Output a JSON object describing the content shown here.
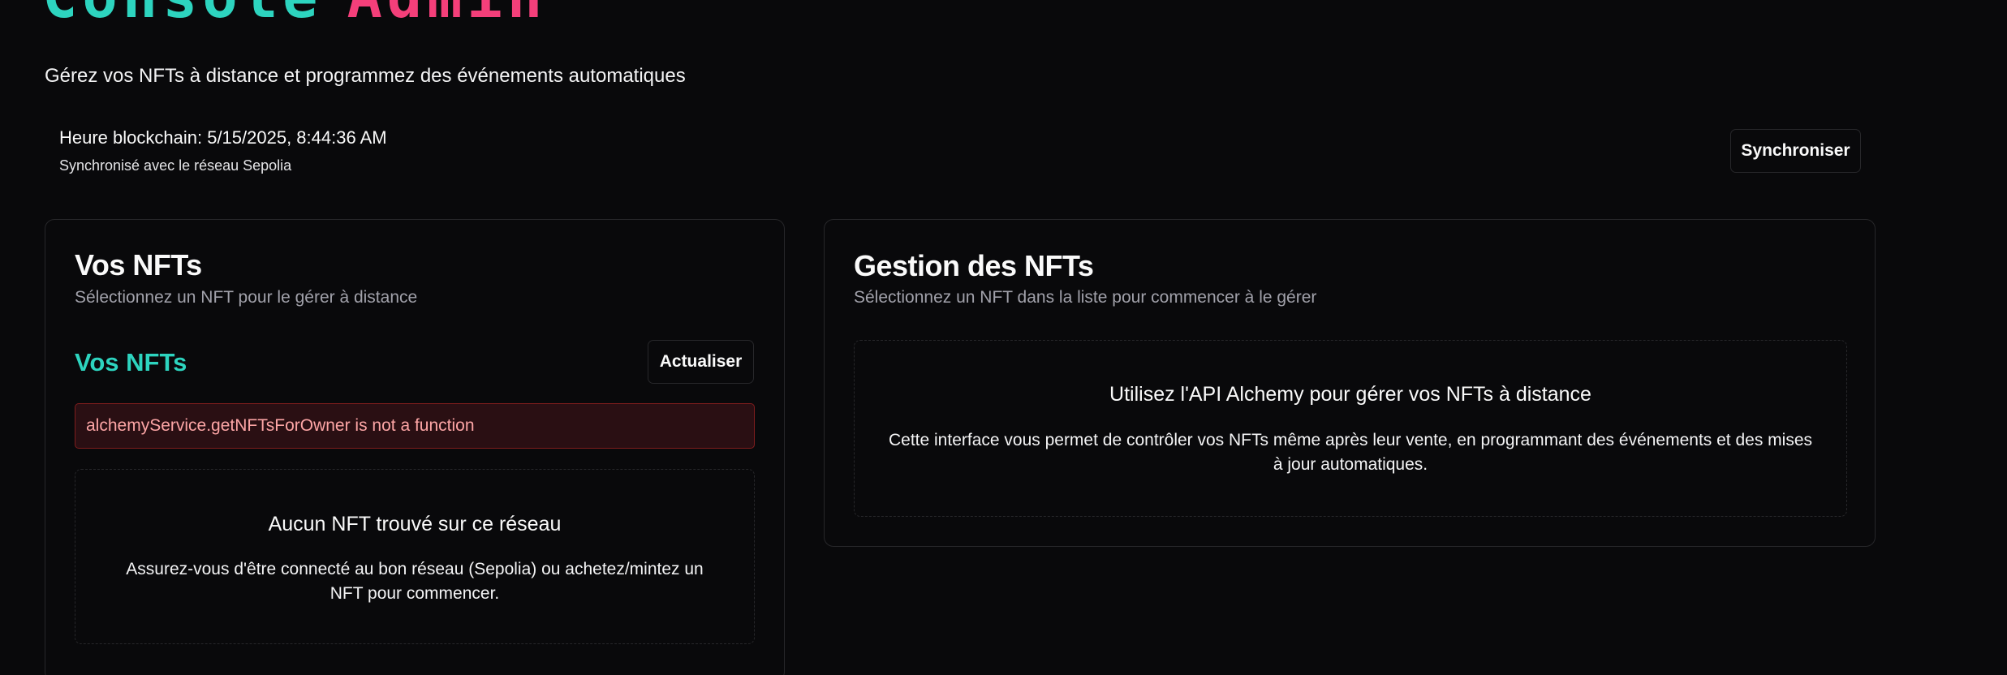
{
  "header": {
    "title_part1": "Console",
    "title_part2": "Admin",
    "subtitle": "Gérez vos NFTs à distance et programmez des événements automatiques"
  },
  "blockchain": {
    "time_label": "Heure blockchain: 5/15/2025, 8:44:36 AM",
    "sync_status": "Synchronisé avec le réseau Sepolia",
    "sync_button": "Synchroniser"
  },
  "nft_list_card": {
    "title": "Vos NFTs",
    "description": "Sélectionnez un NFT pour le gérer à distance",
    "section_title": "Vos NFTs",
    "refresh_button": "Actualiser",
    "error_message": "alchemyService.getNFTsForOwner is not a function",
    "empty_title": "Aucun NFT trouvé sur ce réseau",
    "empty_text": "Assurez-vous d'être connecté au bon réseau (Sepolia) ou achetez/mintez un NFT pour commencer."
  },
  "management_card": {
    "title": "Gestion des NFTs",
    "description": "Sélectionnez un NFT dans la liste pour commencer à le gérer",
    "info_title": "Utilisez l'API Alchemy pour gérer vos NFTs à distance",
    "info_text": "Cette interface vous permet de contrôler vos NFTs même après leur vente, en programmant des événements et des mises à jour automatiques."
  },
  "colors": {
    "background": "#09090b",
    "accent_teal": "#2dd4bf",
    "accent_pink": "#f43f7a",
    "error_text": "#fca5a5",
    "error_bg": "#2a0f13",
    "border": "#27272a",
    "muted_text": "#a1a1aa"
  }
}
